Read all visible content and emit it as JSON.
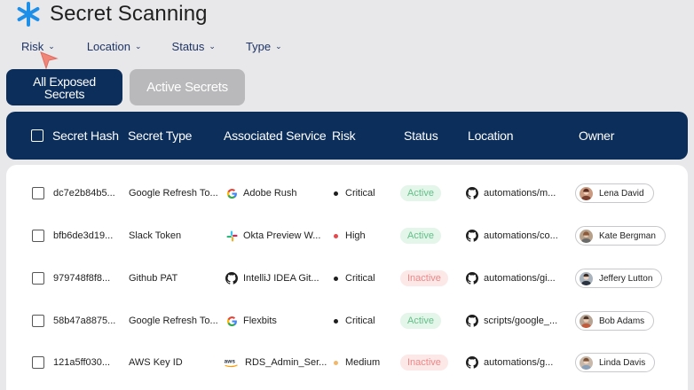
{
  "app": {
    "title": "Secret Scanning"
  },
  "filters": [
    {
      "label": "Risk"
    },
    {
      "label": "Location"
    },
    {
      "label": "Status"
    },
    {
      "label": "Type"
    }
  ],
  "segments": {
    "all_line1": "All Exposed",
    "all_line2": "Secrets",
    "active": "Active Secrets"
  },
  "columns": {
    "hash": "Secret Hash",
    "type": "Secret Type",
    "service": "Associated Service",
    "risk": "Risk",
    "status": "Status",
    "location": "Location",
    "owner": "Owner"
  },
  "colors": {
    "primary": "#0c2e5b",
    "critical": "#1e1e1e",
    "high": "#e5484d",
    "medium": "#f1b86b",
    "active_text": "#62c088",
    "inactive_text": "#ec8787"
  },
  "rows": [
    {
      "hash": "dc7e2b84b5...",
      "type": "Google Refresh To...",
      "service_icon": "google-icon",
      "service": "Adobe Rush",
      "risk": "Critical",
      "status": "Active",
      "location": "automations/m...",
      "owner": "Lena David"
    },
    {
      "hash": "bfb6de3d19...",
      "type": "Slack Token",
      "service_icon": "slack-icon",
      "service": "Okta Preview W...",
      "risk": "High",
      "status": "Active",
      "location": "automations/co...",
      "owner": "Kate Bergman"
    },
    {
      "hash": "979748f8f8...",
      "type": "Github PAT",
      "service_icon": "github-icon",
      "service": "IntelliJ IDEA Git...",
      "risk": "Critical",
      "status": "Inactive",
      "location": "automations/gi...",
      "owner": "Jeffery Lutton"
    },
    {
      "hash": "58b47a8875...",
      "type": "Google Refresh To...",
      "service_icon": "google-icon",
      "service": "Flexbits",
      "risk": "Critical",
      "status": "Active",
      "location": "scripts/google_...",
      "owner": "Bob Adams"
    },
    {
      "hash": "121a5ff030...",
      "type": "AWS Key ID",
      "service_icon": "aws-icon",
      "service": "RDS_Admin_Ser...",
      "risk": "Medium",
      "status": "Inactive",
      "location": "automations/g...",
      "owner": "Linda Davis"
    }
  ]
}
